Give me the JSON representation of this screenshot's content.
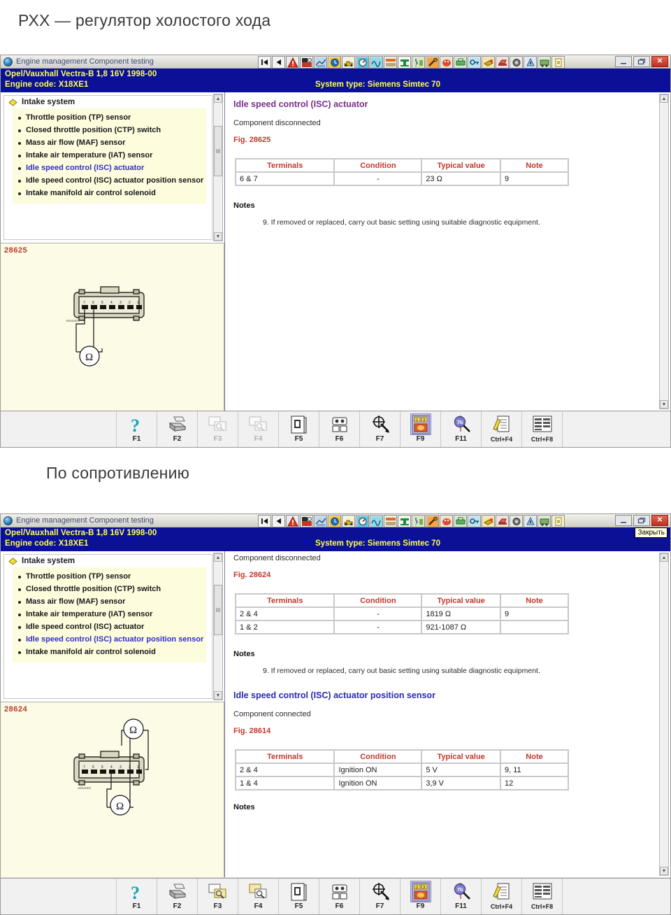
{
  "slides": [
    {
      "heading": "РХХ — регулятор холостого хода"
    },
    {
      "heading": "По сопротивлению"
    }
  ],
  "colors": {
    "infobar_bg": "#0b1196",
    "infobar_text": "#ffff54",
    "heading_purple": "#7b2d8b",
    "heading_blue": "#2a2ab0",
    "fig_red": "#c0392b",
    "tree_bg": "#fdfcdc",
    "selected_item": "#2f2fc8"
  },
  "window": {
    "title": "Engine management Component testing",
    "title_icon": "globe-icon",
    "vehicle_line": "Opel/Vauxhall   Vectra-B  1,8 16V 1998-00",
    "engine_line": "Engine code: X18XE1",
    "system_type": "System type: Siemens Simtec 70",
    "window_buttons": [
      {
        "name": "minimize",
        "glyph": "–"
      },
      {
        "name": "restore",
        "glyph": "❐"
      },
      {
        "name": "close",
        "glyph": "✕"
      }
    ],
    "toolbar_icons": [
      "first-record-icon",
      "previous-record-icon",
      "warning-triangle-icon",
      "safety-icon",
      "wiring-diagram-icon",
      "clock-gauge-icon",
      "engine-icon",
      "gauge-icon",
      "oscilloscope-icon",
      "belt-icon",
      "brakes-icon",
      "suspension-icon",
      "wrench-icon",
      "airbag-icon",
      "printer-blue-icon",
      "key-icon",
      "torch-icon",
      "lift-icon",
      "wheel-icon",
      "tyre-icon",
      "parts-icon",
      "manual-icon"
    ]
  },
  "tooltip": {
    "close_label": "Закрыть"
  },
  "tree": {
    "root_label": "Intake system",
    "root_icon": "diamond-icon",
    "items": [
      "Throttle position (TP) sensor",
      "Closed throttle position (CTP) switch",
      "Mass air flow (MAF) sensor",
      "Intake air temperature (IAT) sensor",
      "Idle speed control (ISC) actuator",
      "Idle speed control (ISC) actuator position sensor",
      "Intake manifold air control solenoid"
    ]
  },
  "window1": {
    "selected_index": 4,
    "figure_number": "28625",
    "doc": {
      "title": "Idle speed control (ISC) actuator",
      "state": "Component disconnected",
      "fig": "Fig. 28625",
      "table": {
        "headers": [
          "Terminals",
          "Condition",
          "Typical value",
          "Note"
        ],
        "rows": [
          [
            "6 & 7",
            "-",
            "23 Ω",
            "9"
          ]
        ]
      },
      "notes_heading": "Notes",
      "notes": [
        "9. If removed or replaced, carry out basic setting using suitable diagnostic equipment."
      ]
    }
  },
  "window2": {
    "selected_index": 5,
    "figure_number": "28624",
    "doc": {
      "state_top": "Component disconnected",
      "fig_top": "Fig. 28624",
      "table_top": {
        "headers": [
          "Terminals",
          "Condition",
          "Typical value",
          "Note"
        ],
        "rows": [
          [
            "2 & 4",
            "-",
            "1819 Ω",
            "9"
          ],
          [
            "1 & 2",
            "-",
            "921-1087 Ω",
            ""
          ]
        ]
      },
      "notes_heading_top": "Notes",
      "notes_top": [
        "9. If removed or replaced, carry out basic setting using suitable diagnostic equipment."
      ],
      "title2": "Idle speed control (ISC) actuator position sensor",
      "state2": "Component connected",
      "fig2": "Fig. 28614",
      "table2": {
        "headers": [
          "Terminals",
          "Condition",
          "Typical value",
          "Note"
        ],
        "rows": [
          [
            "2 & 4",
            "Ignition ON",
            "5 V",
            "9, 11"
          ],
          [
            "1 & 4",
            "Ignition ON",
            "3,9 V",
            "12"
          ]
        ]
      },
      "notes_heading2": "Notes"
    }
  },
  "fkeys": [
    {
      "key": "F1",
      "icon": "help-question-icon",
      "enabled": true
    },
    {
      "key": "F2",
      "icon": "printer-icon",
      "enabled": true
    },
    {
      "key": "F3",
      "icon": "previous-image-icon",
      "enabled": false
    },
    {
      "key": "F4",
      "icon": "next-image-icon",
      "enabled": false
    },
    {
      "key": "F5",
      "icon": "component-location-icon",
      "enabled": true
    },
    {
      "key": "F6",
      "icon": "connector-icon",
      "enabled": true
    },
    {
      "key": "F7",
      "icon": "test-probe-icon",
      "enabled": true
    },
    {
      "key": "F9",
      "icon": "pinout-icon",
      "enabled": true
    },
    {
      "key": "F11",
      "icon": "magnifier-icon",
      "enabled": true
    },
    {
      "key": "Ctrl+F4",
      "icon": "notes-edit-icon",
      "enabled": true
    },
    {
      "key": "Ctrl+F8",
      "icon": "datalist-icon",
      "enabled": true
    }
  ],
  "fkeys2": [
    {
      "key": "F1",
      "icon": "help-question-icon",
      "enabled": true
    },
    {
      "key": "F2",
      "icon": "printer-icon",
      "enabled": true
    },
    {
      "key": "F3",
      "icon": "previous-image-icon",
      "enabled": true
    },
    {
      "key": "F4",
      "icon": "next-image-icon",
      "enabled": true
    },
    {
      "key": "F5",
      "icon": "component-location-icon",
      "enabled": true
    },
    {
      "key": "F6",
      "icon": "connector-icon",
      "enabled": true
    },
    {
      "key": "F7",
      "icon": "test-probe-icon",
      "enabled": true
    },
    {
      "key": "F9",
      "icon": "pinout-icon",
      "enabled": true
    },
    {
      "key": "F11",
      "icon": "magnifier-icon",
      "enabled": true
    },
    {
      "key": "Ctrl+F4",
      "icon": "notes-edit-icon",
      "enabled": true
    },
    {
      "key": "Ctrl+F8",
      "icon": "datalist-icon",
      "enabled": true
    }
  ]
}
